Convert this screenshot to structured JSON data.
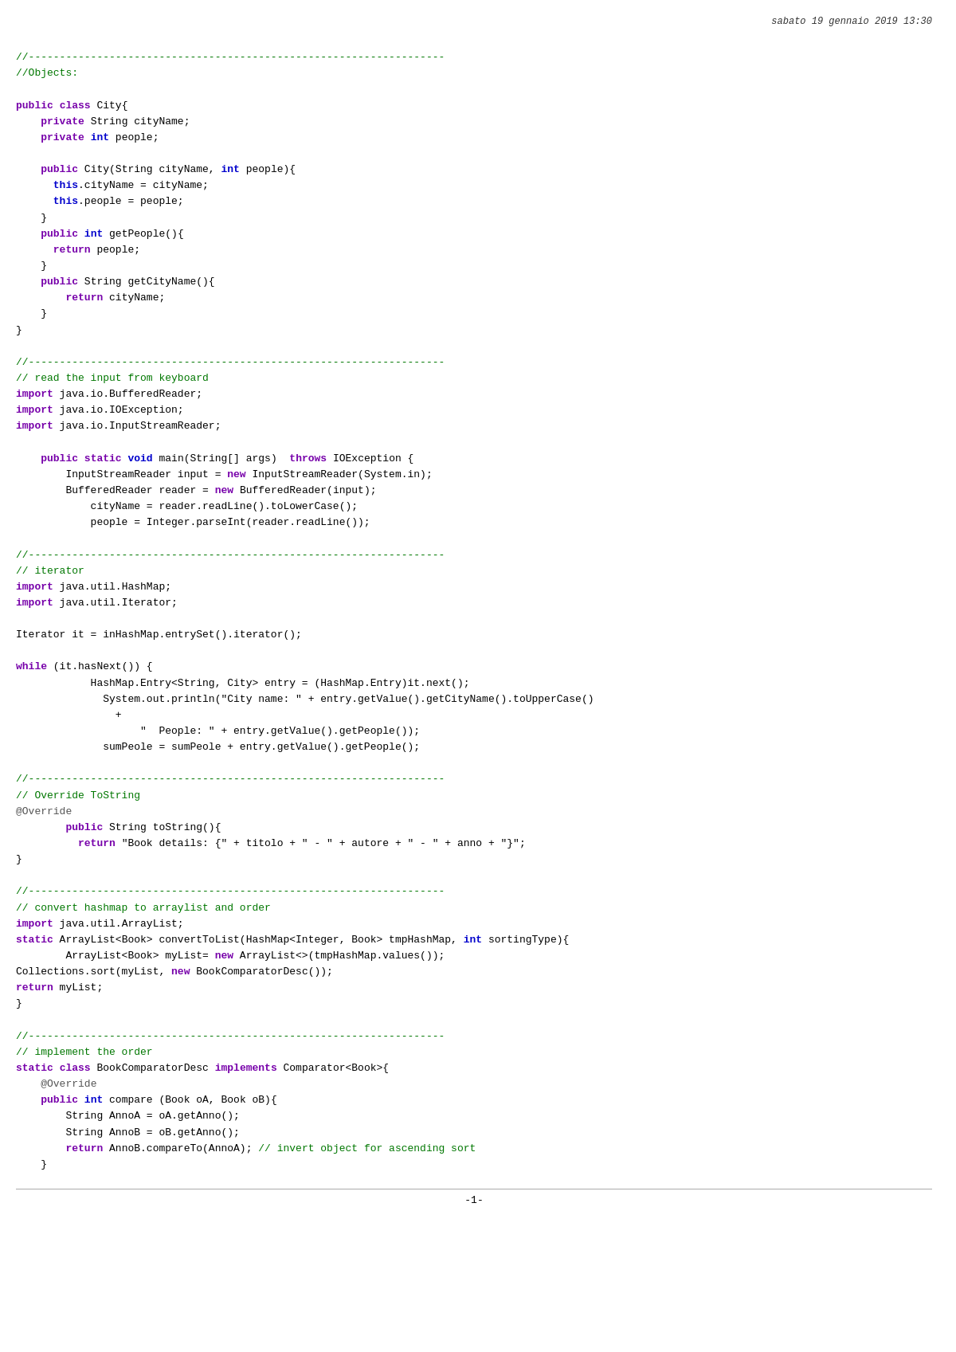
{
  "header": {
    "date": "sabato 19 gennaio 2019 13:30"
  },
  "footer": {
    "page": "-1-"
  }
}
